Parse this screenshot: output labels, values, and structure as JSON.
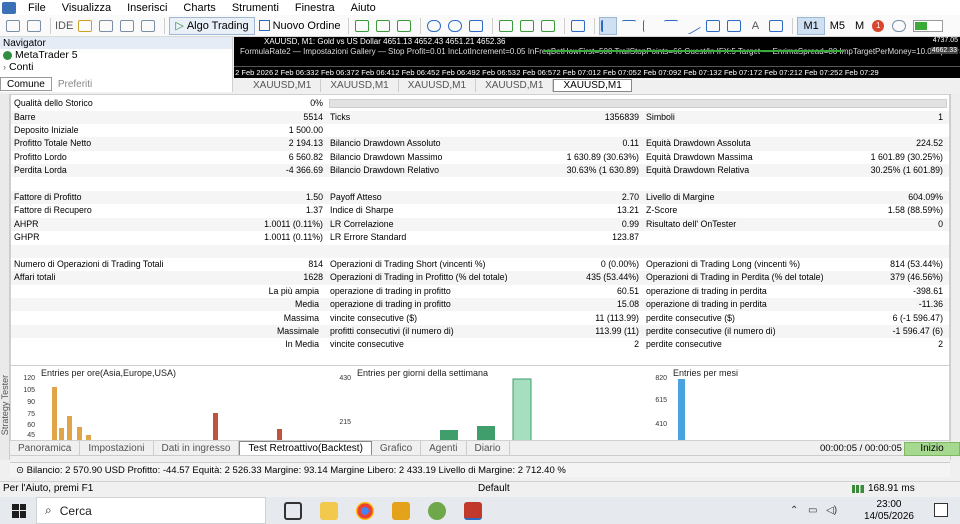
{
  "menu": [
    "File",
    "Visualizza",
    "Inserisci",
    "Charts",
    "Strumenti",
    "Finestra",
    "Aiuto"
  ],
  "toolbar": {
    "ide": "IDE",
    "algo_trading": "Algo Trading",
    "new_order": "Nuovo Ordine",
    "timeframes": [
      "M1",
      "M5",
      "M"
    ],
    "active_timeframe": "M1",
    "notifications": "1"
  },
  "navigator": {
    "title": "Navigator",
    "items": [
      "MetaTrader 5",
      "Conti"
    ],
    "tabs": [
      "Comune",
      "Preferiti"
    ]
  },
  "chart": {
    "header": "XAUUSD, M1:  Gold vs US Dollar  4651.13  4652.43  4651.21  4652.36",
    "indicator": "FormulaRate2  —  Impostazioni Gallery  —  Stop Profit=0.01  IncLotIncrement=0.05  InFreqBetHowFirst=500  TrailStopPoints=66  Guest/In IFX:5  Target  —  EnrimaSpread=80  ImpTargetPerMoney=10.0  InpExtraDrawdown",
    "price_top": "4737.05",
    "price_mid": "4662.33",
    "axis": [
      "2 Feb 2026",
      "2 Feb 06:33",
      "2 Feb 06:37",
      "2 Feb 06:41",
      "2 Feb 06:45",
      "2 Feb 06:49",
      "2 Feb 06:53",
      "2 Feb 06:57",
      "2 Feb 07:01",
      "2 Feb 07:05",
      "2 Feb 07:09",
      "2 Feb 07:13",
      "2 Feb 07:17",
      "2 Feb 07:21",
      "2 Feb 07:25",
      "2 Feb 07:29"
    ],
    "tabs": [
      "XAUUSD,M1",
      "XAUUSD,M1",
      "XAUUSD,M1",
      "XAUUSD,M1",
      "XAUUSD,M1"
    ],
    "active_tab": 4
  },
  "report": {
    "history_quality_label": "Qualità dello Storico",
    "history_quality_value": "0%",
    "rows": [
      {
        "l1": "Barre",
        "v1": "5514",
        "l2": "Ticks",
        "v2": "1356839",
        "l3": "Simboli",
        "v3": "1"
      },
      {
        "l1": "Deposito Iniziale",
        "v1": "1 500.00",
        "l2": "",
        "v2": "",
        "l3": "",
        "v3": ""
      },
      {
        "l1": "Profitto Totale Netto",
        "v1": "2 194.13",
        "l2": "Bilancio Drawdown Assoluto",
        "v2": "0.11",
        "l3": "Equità Drawdown Assoluta",
        "v3": "224.52"
      },
      {
        "l1": "Profitto Lordo",
        "v1": "6 560.82",
        "l2": "Bilancio Drawdown Massimo",
        "v2": "1 630.89 (30.63%)",
        "l3": "Equità Drawdown Massima",
        "v3": "1 601.89 (30.25%)"
      },
      {
        "l1": "Perdita Lorda",
        "v1": "-4 366.69",
        "l2": "Bilancio Drawdown Relativo",
        "v2": "30.63% (1 630.89)",
        "l3": "Equità Drawdown Relativa",
        "v3": "30.25% (1 601.89)"
      },
      {
        "l1": "",
        "v1": "",
        "l2": "",
        "v2": "",
        "l3": "",
        "v3": ""
      },
      {
        "l1": "Fattore di Profitto",
        "v1": "1.50",
        "l2": "Payoff Atteso",
        "v2": "2.70",
        "l3": "Livello di Margine",
        "v3": "604.09%"
      },
      {
        "l1": "Fattore di Recupero",
        "v1": "1.37",
        "l2": "Indice di Sharpe",
        "v2": "13.21",
        "l3": "Z-Score",
        "v3": "1.58 (88.59%)"
      },
      {
        "l1": "AHPR",
        "v1": "1.0011 (0.11%)",
        "l2": "LR Correlazione",
        "v2": "0.99",
        "l3": "Risultato dell' OnTester",
        "v3": "0"
      },
      {
        "l1": "GHPR",
        "v1": "1.0011 (0.11%)",
        "l2": "LR Errore Standard",
        "v2": "123.87",
        "l3": "",
        "v3": ""
      },
      {
        "l1": "",
        "v1": "",
        "l2": "",
        "v2": "",
        "l3": "",
        "v3": ""
      },
      {
        "l1": "Numero di Operazioni di Trading Totali",
        "v1": "814",
        "l2": "Operazioni di Trading Short (vincenti %)",
        "v2": "0 (0.00%)",
        "l3": "Operazioni di Trading Long (vincenti %)",
        "v3": "814 (53.44%)"
      },
      {
        "l1": "Affari totali",
        "v1": "1628",
        "l2": "Operazioni di Trading in Profitto (% del totale)",
        "v2": "435 (53.44%)",
        "l3": "Operazioni di Trading in Perdita (% del totale)",
        "v3": "379 (46.56%)"
      },
      {
        "r1": "La più ampia",
        "l2": "operazione di trading in profitto",
        "v2": "60.51",
        "l3": "operazione di trading in perdita",
        "v3": "-398.61"
      },
      {
        "r1": "Media",
        "l2": "operazione di trading in profitto",
        "v2": "15.08",
        "l3": "operazione di trading in perdita",
        "v3": "-11.36"
      },
      {
        "r1": "Massima",
        "l2": "vincite consecutive ($)",
        "v2": "11 (113.99)",
        "l3": "perdite consecutive ($)",
        "v3": "6 (-1 596.47)"
      },
      {
        "r1": "Massimale",
        "l2": "profitti consecutivi (il numero di)",
        "v2": "113.99 (11)",
        "l3": "perdite consecutive (il numero di)",
        "v3": "-1 596.47 (6)"
      },
      {
        "r1": "In Media",
        "l2": "vincite consecutive",
        "v2": "2",
        "l3": "perdite consecutive",
        "v3": "2"
      }
    ]
  },
  "mini_charts": [
    {
      "title": "Entries per ore(Asia,Europe,USA)",
      "yticks": [
        "120",
        "105",
        "90",
        "75",
        "60",
        "45"
      ]
    },
    {
      "title": "Entries per giorni della settimana",
      "yticks": [
        "430",
        "215"
      ]
    },
    {
      "title": "Entries per mesi",
      "yticks": [
        "820",
        "615",
        "410"
      ]
    }
  ],
  "side_label": "Strategy Tester",
  "bottom_tabs": [
    "Panoramica",
    "Impostazioni",
    "Dati in ingresso",
    "Test Retroattivo(Backtest)",
    "Grafico",
    "Agenti",
    "Diario"
  ],
  "active_bottom_tab": 3,
  "timer": "00:00:05 / 00:00:05",
  "start_button": "Inizio",
  "status_line": "Bilancio: 2 570.90 USD  Profitto: -44.57  Equità: 2 526.33  Margine: 93.14  Margine Libero: 2 433.19  Livello di Margine: 2 712.40 %",
  "statusbar": {
    "help": "Per l'Aiuto, premi F1",
    "profile": "Default",
    "ping": "168.91 ms"
  },
  "taskbar": {
    "search": "Cerca",
    "time": "23:00",
    "date": "14/05/2026"
  },
  "colors": {
    "chart_bg": "#000000",
    "accent": "#3aaa3a",
    "start_btn": "#a7d88f",
    "bar_orange": "#e0a548",
    "bar_red": "#c0533e",
    "bar_green": "#3f9e6b",
    "bar_light_green": "#a6dfbf",
    "bar_blue": "#4aa3df"
  }
}
